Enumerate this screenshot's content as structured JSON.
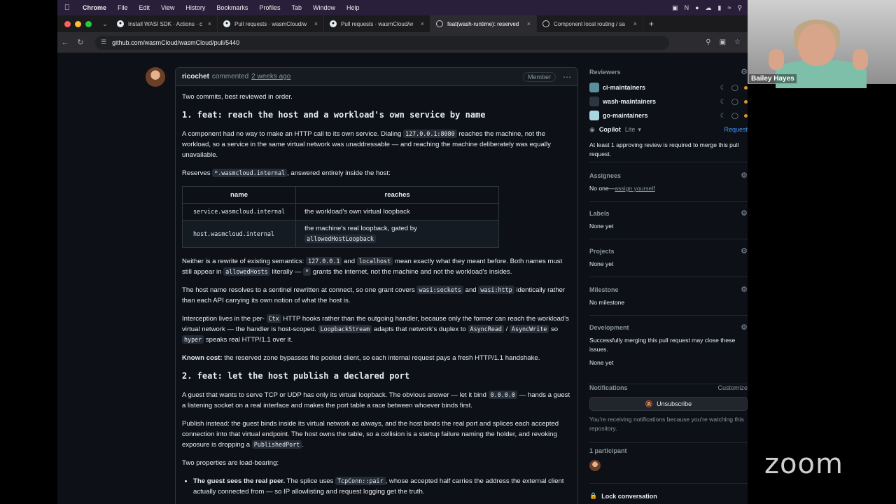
{
  "menubar": {
    "app": "Chrome",
    "items": [
      "File",
      "Edit",
      "View",
      "History",
      "Bookmarks",
      "Profiles",
      "Tab",
      "Window",
      "Help"
    ]
  },
  "tabs": [
    {
      "title": "Install WASI SDK · Actions · c"
    },
    {
      "title": "Pull requests · wasmCloud/w"
    },
    {
      "title": "Pull requests · wasmCloud/w"
    },
    {
      "title": "feat(wash-runtime): reserved"
    },
    {
      "title": "Component local routing / sa"
    }
  ],
  "address": {
    "url": "github.com/wasmCloud/wasmCloud/pull/5440"
  },
  "comment": {
    "author": "ricochet",
    "action": "commented",
    "when": "2 weeks ago",
    "role": "Member",
    "intro": "Two commits, best reviewed in order.",
    "h1": "1. feat: reach the host and a workload's own service by name",
    "p1a": "A component had no way to make an HTTP call to its own service. Dialing ",
    "p1code": "127.0.0.1:8080",
    "p1b": " reaches the machine, not the workload, so a service in the same virtual network was unaddressable — and reaching the machine deliberately was equally unavailable.",
    "p2a": "Reserves ",
    "p2code": "*.wasmcloud.internal",
    "p2b": ", answered entirely inside the host:",
    "table": {
      "h_name": "name",
      "h_reaches": "reaches",
      "r1_name": "service.wasmcloud.internal",
      "r1_reaches": "the workload's own virtual loopback",
      "r2_name": "host.wasmcloud.internal",
      "r2_reaches": "the machine's real loopback, gated by ",
      "r2_code": "allowedHostLoopback"
    },
    "p3a": "Neither is a rewrite of existing semantics: ",
    "p3c1": "127.0.0.1",
    "p3b": " and ",
    "p3c2": "localhost",
    "p3d": " mean exactly what they meant before. Both names must still appear in ",
    "p3c3": "allowedHosts",
    "p3e": " literally — ",
    "p3c4": "*",
    "p3f": " grants the internet, not the machine and not the workload's insides.",
    "p4a": "The host name resolves to a sentinel rewritten at connect, so one grant covers ",
    "p4c1": "wasi:sockets",
    "p4b": " and ",
    "p4c2": "wasi:http",
    "p4d": " identically rather than each API carrying its own notion of what the host is.",
    "p5a": "Interception lives in the per- ",
    "p5c1": "Ctx",
    "p5b": " HTTP hooks rather than the outgoing handler, because only the former can reach the workload's virtual network — the handler is host-scoped. ",
    "p5c2": "LoopbackStream",
    "p5d": " adapts that network's duplex to ",
    "p5c3": "AsyncRead",
    "p5e": " / ",
    "p5c4": "AsyncWrite",
    "p5f": " so ",
    "p5c5": "hyper",
    "p5g": " speaks real HTTP/1.1 over it.",
    "p6bold": "Known cost:",
    "p6": " the reserved zone bypasses the pooled client, so each internal request pays a fresh HTTP/1.1 handshake.",
    "h2": "2. feat: let the host publish a declared port",
    "p7a": "A guest that wants to serve TCP or UDP has only its virtual loopback. The obvious answer — let it bind ",
    "p7code": "0.0.0.0",
    "p7b": " — hands a guest a listening socket on a real interface and makes the port table a race between whoever binds first.",
    "p8a": "Publish instead: the guest binds inside its virtual network as always, and the host binds the real port and splices each accepted connection into that virtual endpoint. The host owns the table, so a collision is a startup failure naming the holder, and revoking exposure is dropping a ",
    "p8code": "PublishedPort",
    "p8b": ".",
    "p9": "Two properties are load-bearing:",
    "li1bold": "The guest sees the real peer.",
    "li1a": " The splice uses ",
    "li1code": "TcpConn::pair",
    "li1b": ", whose accepted half carries the address the external client actually connected from — so IP allowlisting and request logging get the truth."
  },
  "sidebar": {
    "reviewers_title": "Reviewers",
    "reviewers": [
      "ci-maintainers",
      "wash-maintainers",
      "go-maintainers"
    ],
    "copilot": "Copilot",
    "copilot_tier": "Lite",
    "request": "Request",
    "approval_note": "At least 1 approving review is required to merge this pull request.",
    "assignees_title": "Assignees",
    "assignees_none": "No one—",
    "assign_yourself": "assign yourself",
    "labels_title": "Labels",
    "labels_none": "None yet",
    "projects_title": "Projects",
    "projects_none": "None yet",
    "milestone_title": "Milestone",
    "milestone_none": "No milestone",
    "development_title": "Development",
    "development_note": "Successfully merging this pull request may close these issues.",
    "development_none": "None yet",
    "notifications_title": "Notifications",
    "customize": "Customize",
    "unsubscribe": "Unsubscribe",
    "notif_note": "You're receiving notifications because you're watching this repository.",
    "participants": "1 participant",
    "lock": "Lock conversation"
  },
  "webcam": {
    "name": "Bailey Hayes"
  },
  "overlay": {
    "logo": "zoom"
  }
}
